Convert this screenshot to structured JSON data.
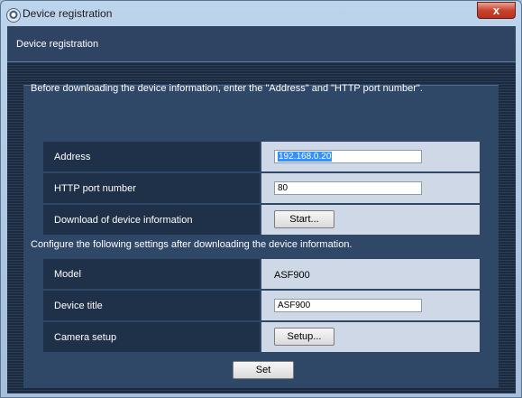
{
  "window": {
    "title": "Device registration",
    "close_label": "x"
  },
  "header": {
    "title": "Device registration"
  },
  "intro": "Before downloading the device information, enter the \"Address\" and \"HTTP port number\".",
  "address": {
    "label": "Address",
    "value": "192.168.0.20"
  },
  "http_port": {
    "label": "HTTP port number",
    "value": "80"
  },
  "download": {
    "label": "Download of device information",
    "button": "Start..."
  },
  "note": "Configure the following settings after downloading the device information.",
  "model": {
    "label": "Model",
    "value": "ASF900"
  },
  "device_title": {
    "label": "Device title",
    "value": "ASF900"
  },
  "camera_setup": {
    "label": "Camera setup",
    "button": "Setup..."
  },
  "set_button": "Set"
}
